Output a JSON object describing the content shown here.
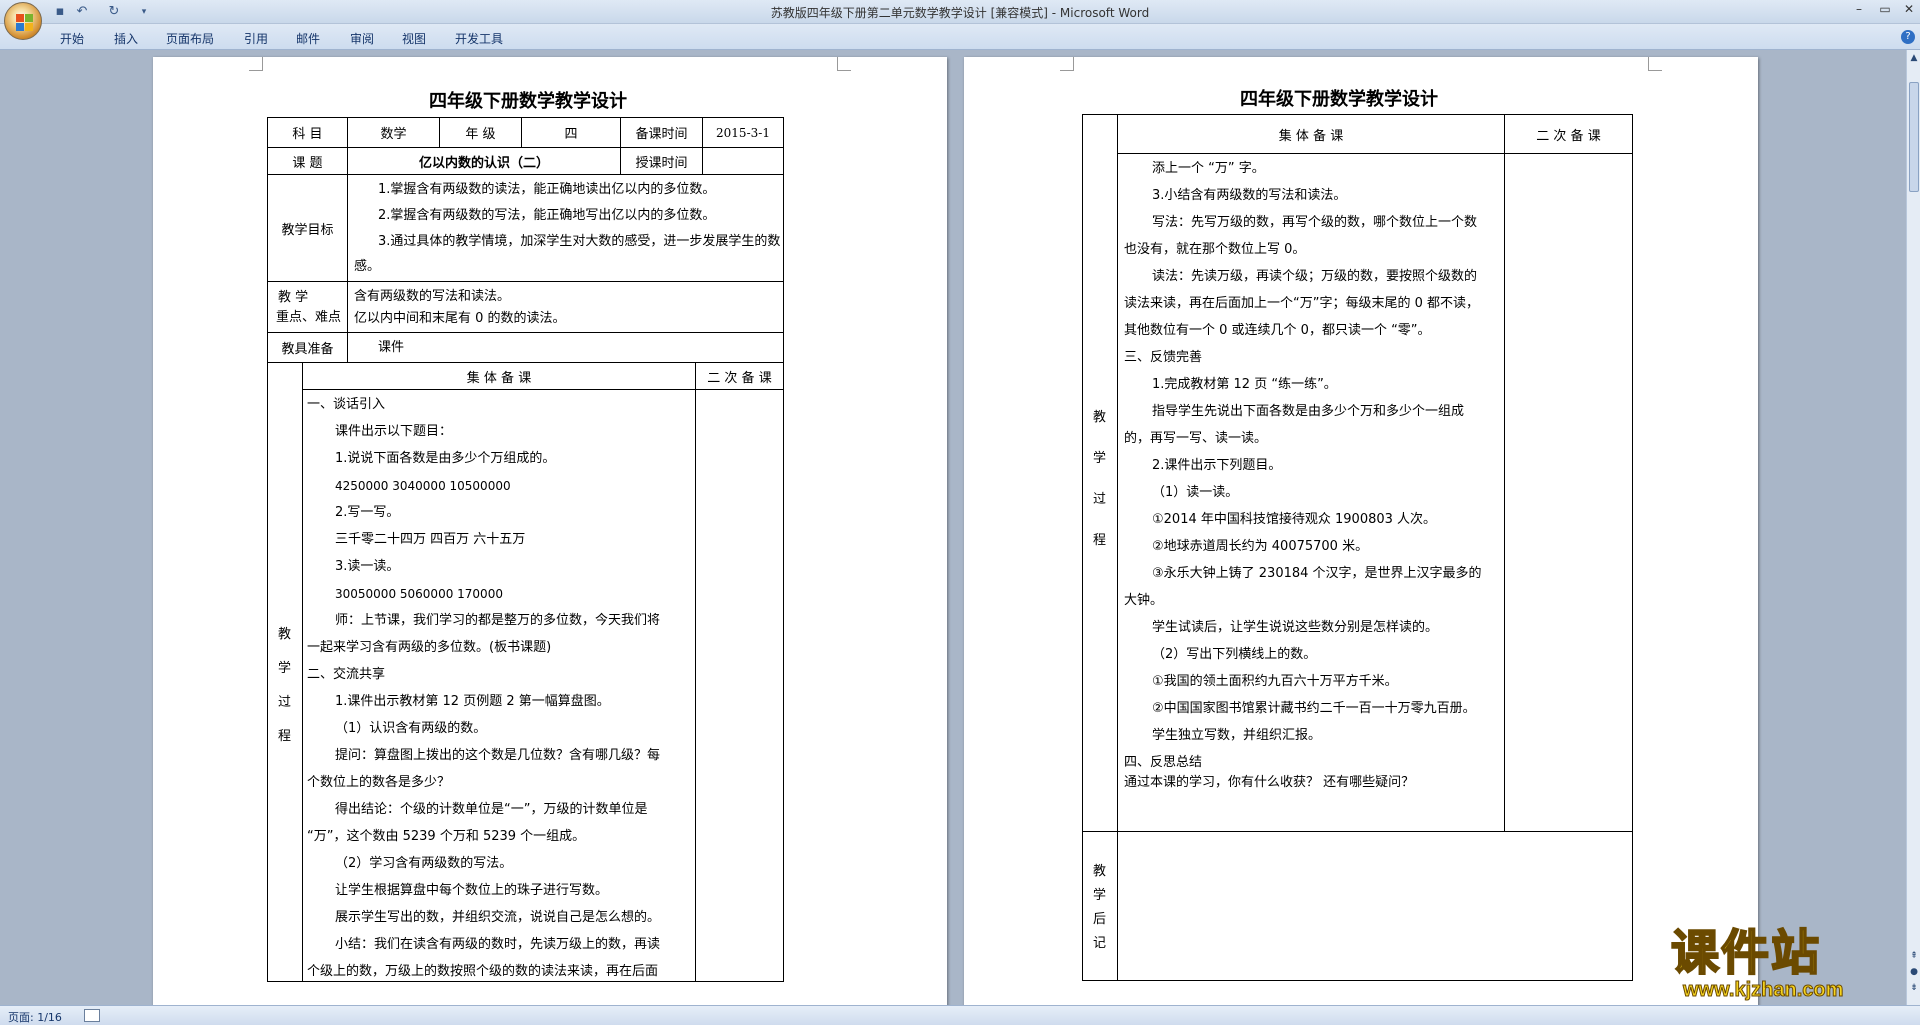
{
  "window": {
    "title": "苏教版四年级下册第二单元数学教学设计 [兼容模式] - Microsoft Word",
    "minimize": "–",
    "maximize": "▭",
    "close": "✕"
  },
  "qat": {
    "save_icon": "save-icon",
    "undo_icon": "undo-icon",
    "redo_icon": "redo-icon",
    "customize_icon": "chevron-down-icon"
  },
  "ribbon": {
    "tabs": [
      "开始",
      "插入",
      "页面布局",
      "引用",
      "邮件",
      "审阅",
      "视图",
      "开发工具"
    ],
    "help": "?"
  },
  "statusbar": {
    "page": "页面: 1/16"
  },
  "watermark": {
    "text": "课件站",
    "url": "www.kjzhan.com"
  },
  "page1": {
    "title": "四年级下册数学教学设计",
    "info": {
      "subject_label": "科 目",
      "subject": "数学",
      "grade_label": "年 级",
      "grade": "四",
      "prep_time_label": "备课时间",
      "prep_time": "2015-3-1",
      "topic_label": "课 题",
      "topic": "亿以内数的认识（二）",
      "teach_time_label": "授课时间"
    },
    "goals_label": "教学目标",
    "goals": [
      "1.掌握含有两级数的读法，能正确地读出亿以内的多位数。",
      "2.掌握含有两级数的写法，能正确地写出亿以内的多位数。",
      "3.通过具体的教学情境，加深学生对大数的感受，进一步发展学生的数",
      "感。"
    ],
    "keypoints_label_1": "教    学",
    "keypoints_label_2": "重点、难点",
    "keypoints": [
      "含有两级数的写法和读法。",
      "亿以内中间和末尾有 0 的数的读法。"
    ],
    "tools_label": "教具准备",
    "tools": "课件",
    "process_label": [
      "教",
      "学",
      "过",
      "程"
    ],
    "collective_header": "集 体 备 课",
    "second_header": "二 次 备 课",
    "body": [
      "一、谈话引入",
      "课件出示以下题目：",
      "1.说说下面各数是由多少个万组成的。",
      "4250000      3040000      10500000",
      "2.写一写。",
      "三千零二十四万      四百万      六十五万",
      "3.读一读。",
      "30050000      5060000      170000",
      "师：上节课，我们学习的都是整万的多位数，今天我们将",
      "一起来学习含有两级的多位数。(板书课题)",
      "二、交流共享",
      "1.课件出示教材第 12 页例题 2 第一幅算盘图。",
      "（1）认识含有两级的数。",
      "提问：算盘图上拨出的这个数是几位数？含有哪几级？每",
      "个数位上的数各是多少？",
      "得出结论：个级的计数单位是“一”，万级的计数单位是",
      "“万”，这个数由 5239 个万和 5239 个一组成。",
      "（2）学习含有两级数的写法。",
      "让学生根据算盘中每个数位上的珠子进行写数。",
      "展示学生写出的数，并组织交流，说说自己是怎么想的。",
      "小结：我们在读含有两级的数时，先读万级上的数，再读",
      "个级上的数，万级上的数按照个级的数的读法来读，再在后面"
    ]
  },
  "page2": {
    "title": "四年级下册数学教学设计",
    "collective_header": "集 体 备 课",
    "second_header": "二 次 备 课",
    "process_label": [
      "教",
      "学",
      "过",
      "程"
    ],
    "body": [
      "添上一个 “万” 字。",
      "3.小结含有两级数的写法和读法。",
      "写法：先写万级的数，再写个级的数，哪个数位上一个数",
      "也没有，就在那个数位上写 0。",
      "读法：先读万级，再读个级；万级的数，要按照个级数的",
      "读法来读，再在后面加上一个“万”字；每级末尾的 0 都不读，",
      "其他数位有一个 0 或连续几个 0，都只读一个 “零”。",
      "三、反馈完善",
      "1.完成教材第 12 页 “练一练”。",
      "指导学生先说出下面各数是由多少个万和多少个一组成",
      "的，再写一写、读一读。",
      "2.课件出示下列题目。",
      "（1）读一读。",
      "①2014 年中国科技馆接待观众 1900803 人次。",
      "②地球赤道周长约为 40075700 米。",
      "③永乐大钟上铸了 230184 个汉字，是世界上汉字最多的",
      "大钟。",
      "学生试读后，让学生说说这些数分别是怎样读的。",
      "（2）写出下列横线上的数。",
      "①我国的领土面积约九百六十万平方千米。",
      "②中国国家图书馆累计藏书约二千一百一十万零九百册。",
      "学生独立写数，并组织汇报。",
      "四、反思总结",
      "通过本课的学习，你有什么收获？ 还有哪些疑问？"
    ],
    "after_label": [
      "教",
      "学",
      "后",
      "记"
    ]
  }
}
